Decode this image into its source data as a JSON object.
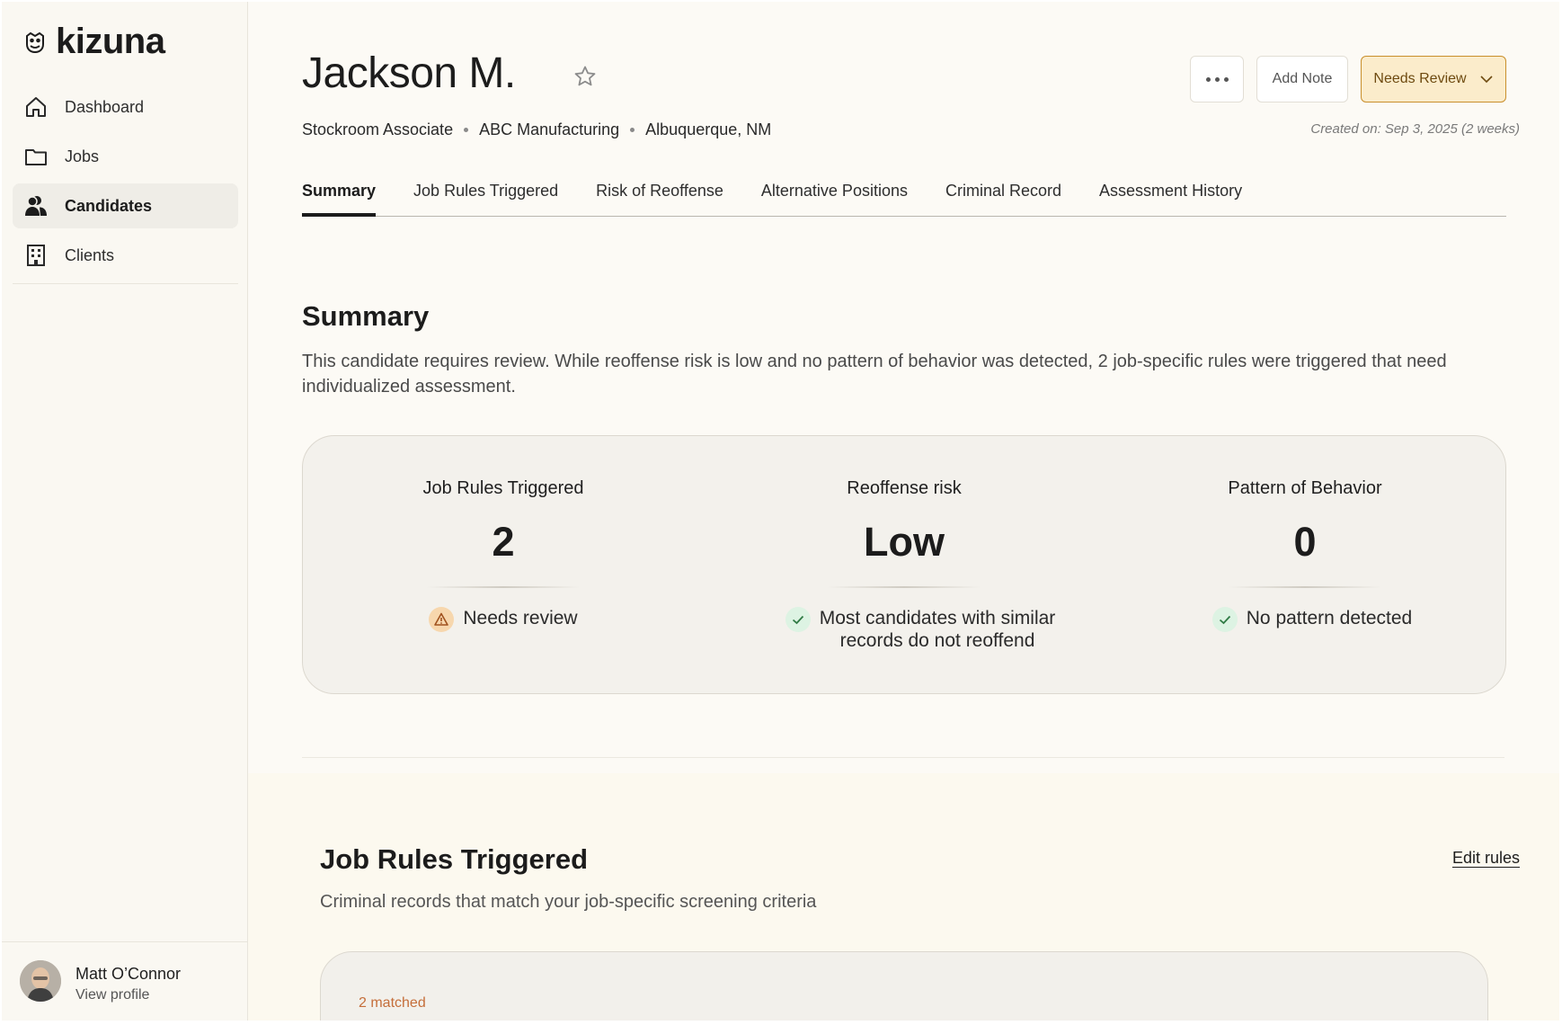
{
  "app": {
    "name": "kizuna"
  },
  "sidebar": {
    "items": [
      {
        "label": "Dashboard",
        "icon": "home-icon"
      },
      {
        "label": "Jobs",
        "icon": "folder-icon"
      },
      {
        "label": "Candidates",
        "icon": "people-icon",
        "active": true
      },
      {
        "label": "Clients",
        "icon": "building-icon"
      }
    ],
    "profile": {
      "name": "Matt O’Connor",
      "link": "View profile"
    }
  },
  "candidate": {
    "name": "Jackson M.",
    "role": "Stockroom Associate",
    "company": "ABC Manufacturing",
    "location": "Albuquerque, NM",
    "created": "Created on: Sep 3, 2025 (2 weeks)"
  },
  "actions": {
    "add_note": "Add Note",
    "status": "Needs Review",
    "status_color": "#fbeccb"
  },
  "tabs": [
    {
      "label": "Summary",
      "active": true
    },
    {
      "label": "Job Rules Triggered"
    },
    {
      "label": "Risk of Reoffense"
    },
    {
      "label": "Alternative Positions"
    },
    {
      "label": "Criminal Record"
    },
    {
      "label": "Assessment History"
    }
  ],
  "summary": {
    "title": "Summary",
    "text": "This candidate requires review. While reoffense risk is low and no pattern of behavior was detected, 2 job-specific rules were triggered that need individualized assessment.",
    "stats": [
      {
        "label": "Job Rules Triggered",
        "value": "2",
        "note": "Needs review",
        "icon": "warning-icon"
      },
      {
        "label": "Reoffense risk",
        "value": "Low",
        "note_line1": "Most candidates with similar",
        "note_line2": "records do not reoffend",
        "icon": "check-icon"
      },
      {
        "label": "Pattern of Behavior",
        "value": "0",
        "note": "No pattern detected",
        "icon": "check-icon"
      }
    ]
  },
  "job_rules": {
    "title": "Job Rules Triggered",
    "edit": "Edit rules",
    "subtitle": "Criminal records that match your job-specific screening criteria",
    "matched": "2 matched"
  }
}
